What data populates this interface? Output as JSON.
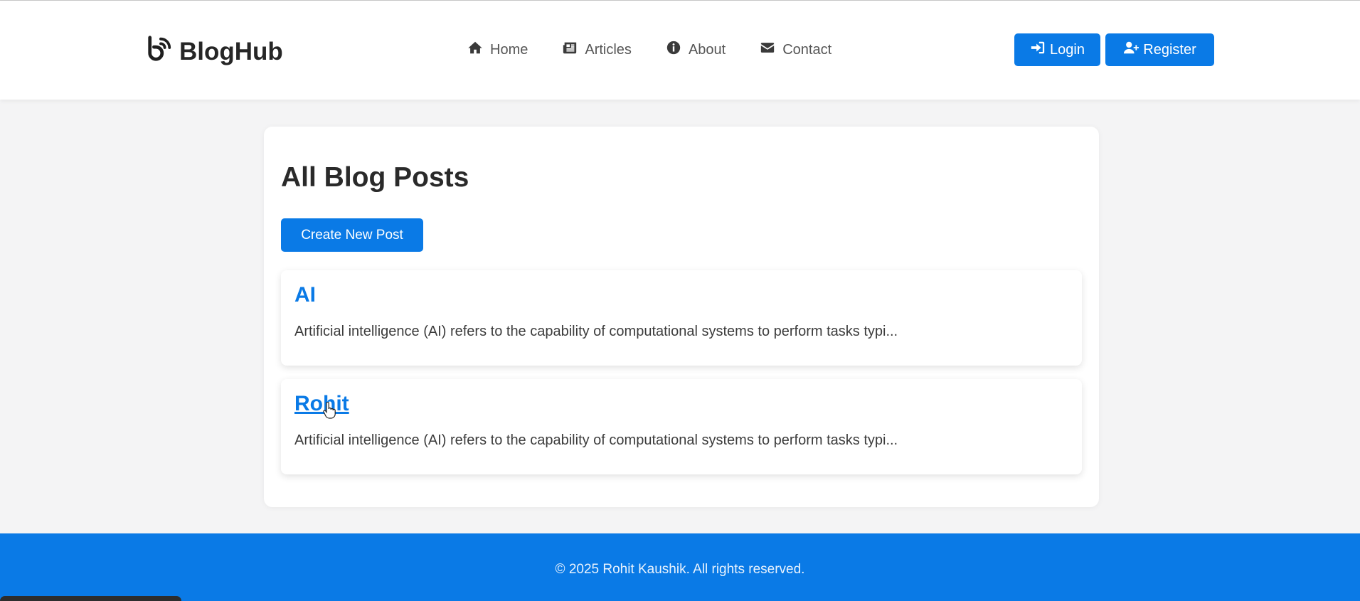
{
  "brand": {
    "name": "BlogHub",
    "icon": "blog-icon"
  },
  "nav": {
    "items": [
      {
        "label": "Home",
        "icon": "home-icon"
      },
      {
        "label": "Articles",
        "icon": "newspaper-icon"
      },
      {
        "label": "About",
        "icon": "info-icon"
      },
      {
        "label": "Contact",
        "icon": "envelope-icon"
      }
    ]
  },
  "auth": {
    "login_label": "Login",
    "login_icon": "sign-in-icon",
    "register_label": "Register",
    "register_icon": "user-plus-icon"
  },
  "main": {
    "title": "All Blog Posts",
    "create_label": "Create New Post",
    "posts": [
      {
        "title": "AI",
        "excerpt": "Artificial intelligence (AI) refers to the capability of computational systems to perform tasks typi..."
      },
      {
        "title": "Rohit",
        "excerpt": "Artificial intelligence (AI) refers to the capability of computational systems to perform tasks typi..."
      }
    ]
  },
  "footer": {
    "text": "© 2025 Rohit Kaushik. All rights reserved."
  },
  "colors": {
    "accent": "#0a7ae6",
    "background": "#f4f4f5",
    "text": "#333333"
  }
}
